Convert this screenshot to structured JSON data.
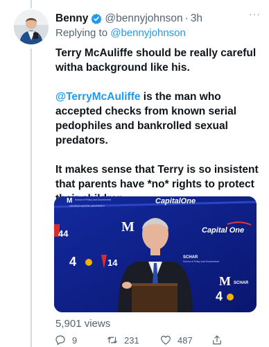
{
  "tweet": {
    "author_name": "Benny",
    "author_handle": "@bennyjohnson",
    "separator": "·",
    "time": "3h",
    "more": "···",
    "replying_label": "Replying to",
    "replying_handle": "@bennyjohnson",
    "paragraph_1": "Terry McAuliffe should be really careful witha background like his.",
    "paragraph_2_mention": "@TerryMcAuliffe",
    "paragraph_2_rest": " is the man who accepted checks from known serial pedophiles and bankrolled sexual predators.",
    "paragraph_3": "It makes sense that Terry is so insistent that parents have *no* rights to protect their children:",
    "views": "5,901 views"
  },
  "media": {
    "backdrop_brands": [
      "CapitalOne",
      "Capital One",
      "SCHAR",
      "SCHAR",
      "44",
      "4",
      "14",
      "4"
    ],
    "backdrop_small": [
      "School of Policy and Government",
      "GEORGE MASON UNIVERSITY",
      "School of Policy and Government"
    ]
  },
  "actions": {
    "replies": "9",
    "retweets": "231",
    "likes": "487"
  },
  "colors": {
    "accent": "#1d9bf0",
    "secondary_text": "#536471",
    "stage_blue": "#0e1f8a"
  },
  "icons": [
    "verified-icon",
    "more-icon",
    "reply-icon",
    "retweet-icon",
    "like-icon",
    "share-icon"
  ]
}
